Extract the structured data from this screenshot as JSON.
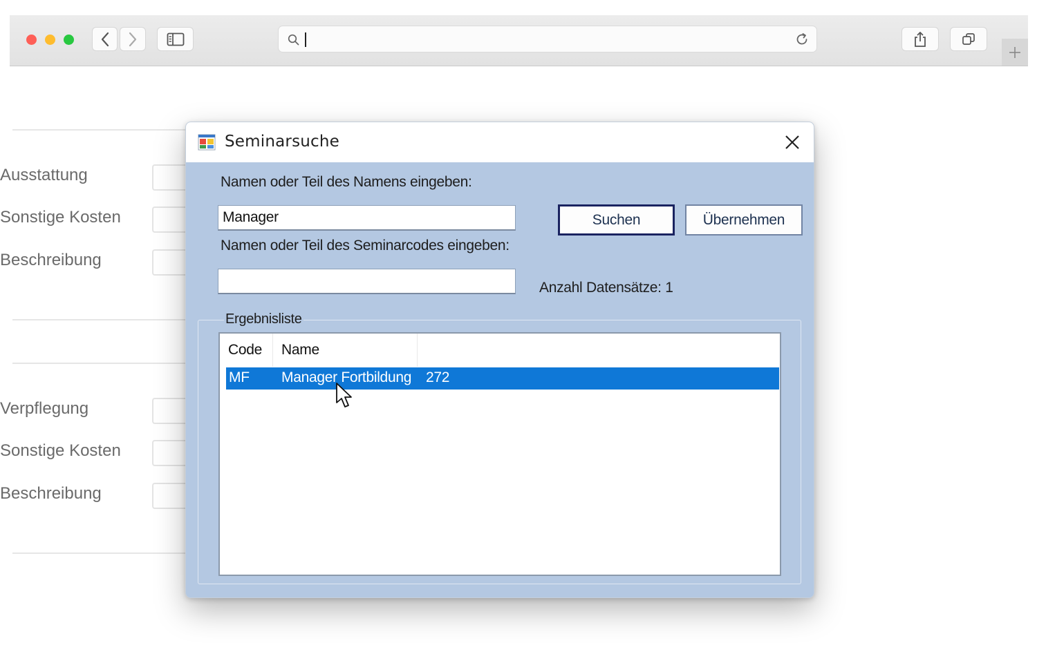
{
  "browser": {
    "url_value": ""
  },
  "background_form": {
    "section1": [
      "Ausstattung",
      "Sonstige Kosten",
      "Beschreibung"
    ],
    "section2": [
      "Verpflegung",
      "Sonstige Kosten",
      "Beschreibung"
    ]
  },
  "dialog": {
    "title": "Seminarsuche",
    "name_prompt": "Namen oder Teil des Namens eingeben:",
    "name_value": "Manager",
    "code_prompt": "Namen oder Teil des Seminarcodes eingeben:",
    "code_value": "",
    "search_button": "Suchen",
    "apply_button": "Übernehmen",
    "record_count": "Anzahl Datensätze: 1",
    "group_title": "Ergebnisliste",
    "columns": [
      "Code",
      "Name",
      ""
    ],
    "rows": [
      {
        "code": "MF",
        "name": "Manager Fortbildung",
        "extra": "272",
        "selected": true
      }
    ]
  },
  "colors": {
    "dialog_background": "#b4c8e2",
    "selection": "#0f78d7",
    "default_button_border": "#1a2360"
  }
}
